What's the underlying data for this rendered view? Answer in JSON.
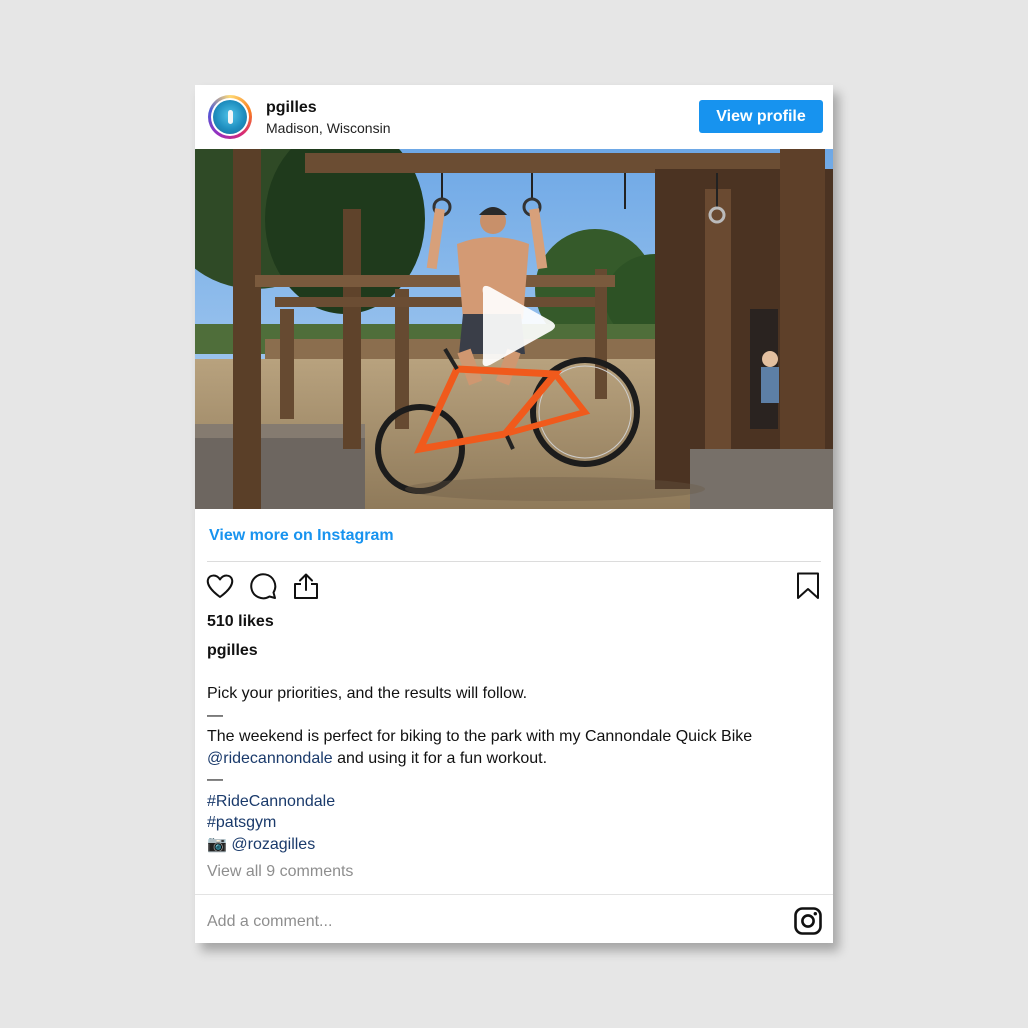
{
  "post": {
    "username": "pgilles",
    "location": "Madison, Wisconsin",
    "view_profile_label": "View profile",
    "view_more_label": "View more on Instagram",
    "likes": "510 likes",
    "caption_username": "pgilles",
    "caption": {
      "line1": "Pick your priorities, and the results will follow.",
      "sep1": "—",
      "line2": "The weekend is perfect for biking to the park with my Cannondale Quick Bike",
      "mention1": "@ridecannondale",
      "line3_rest": " and using it for a fun workout.",
      "sep2": "—",
      "tag1": "#RideCannondale",
      "tag2": "#patsgym",
      "camera_emoji": "📷",
      "mention2": "@rozagilles"
    },
    "view_comments": "View all 9 comments",
    "add_comment_placeholder": "Add a comment..."
  },
  "icons": {
    "like": "heart-icon",
    "comment": "comment-icon",
    "share": "share-icon",
    "save": "bookmark-icon",
    "play": "play-icon",
    "instagram": "instagram-icon"
  },
  "colors": {
    "button_blue": "#1793ef",
    "link_blue": "#1793ef",
    "hashtag_navy": "#1a3a6b",
    "muted_gray": "#8e8e8e",
    "page_bg": "#e6e6e6"
  }
}
